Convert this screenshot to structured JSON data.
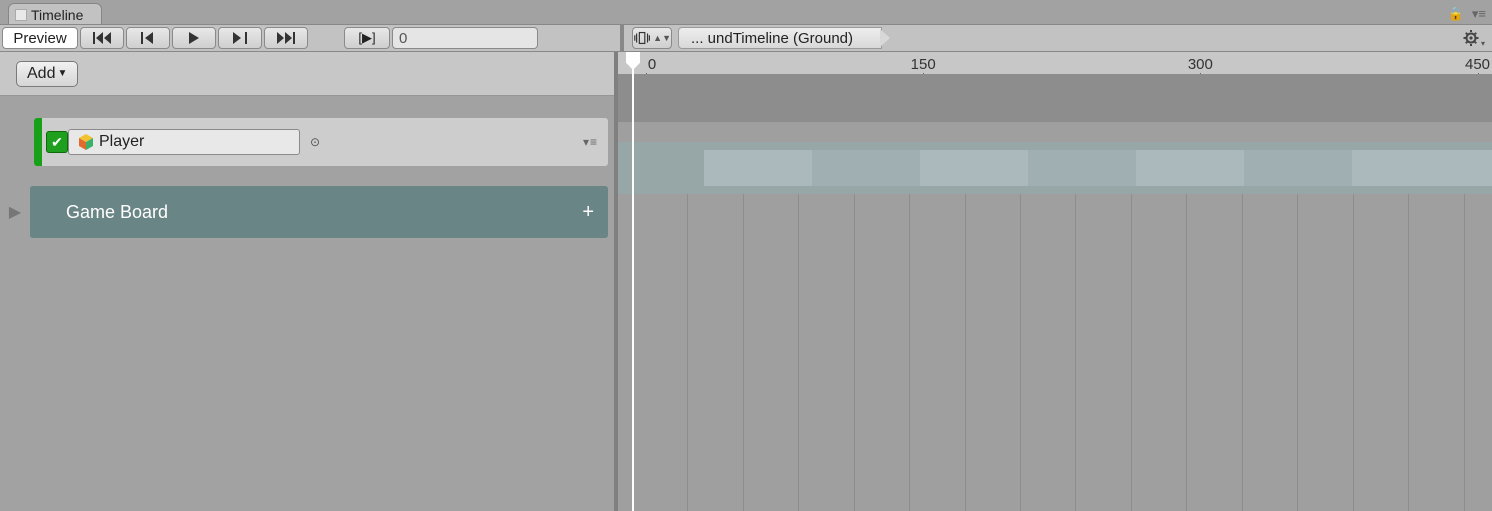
{
  "window": {
    "tabTitle": "Timeline"
  },
  "toolbar": {
    "previewLabel": "Preview",
    "playFrameLabel": "[▶]",
    "frameValue": "0"
  },
  "breadcrumb": {
    "assetName": "... undTimeline (Ground)"
  },
  "addButton": {
    "label": "Add"
  },
  "tracks": {
    "animationTrack": {
      "bindingName": "Player"
    },
    "groupTrack": {
      "name": "Game Board"
    }
  },
  "ruler": {
    "majorTicks": [
      0,
      150,
      300,
      450
    ],
    "minorStep": 30,
    "range": [
      0,
      460
    ]
  },
  "colors": {
    "accentGreen": "#18a018",
    "rulerBlue": "#6ea6ef",
    "groupTeal": "#6a8585"
  }
}
